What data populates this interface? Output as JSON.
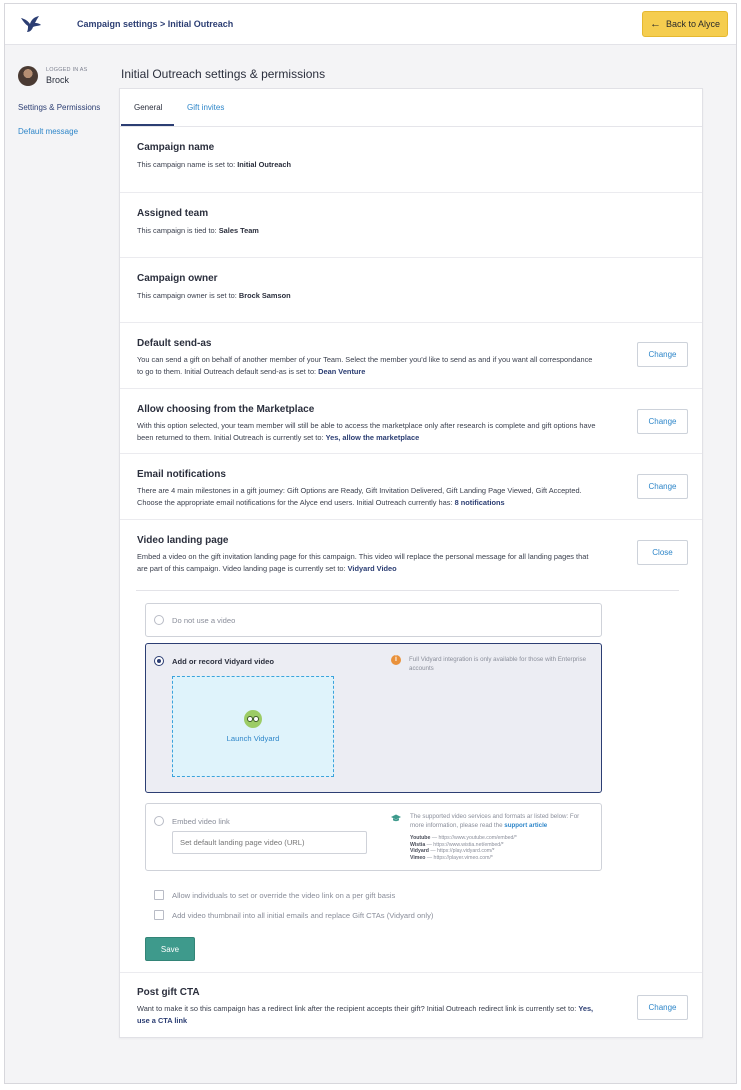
{
  "header": {
    "breadcrumb": "Campaign settings > Initial Outreach",
    "back_label": "Back to Alyce"
  },
  "sidebar": {
    "logged_label": "LOGGED IN AS",
    "user_name": "Brock",
    "items": [
      {
        "label": "Settings & Permissions"
      },
      {
        "label": "Default message"
      }
    ]
  },
  "page": {
    "title": "Initial Outreach settings & permissions"
  },
  "tabs": [
    {
      "label": "General",
      "active": true
    },
    {
      "label": "Gift invites",
      "active": false
    }
  ],
  "sections": {
    "campaign_name": {
      "title": "Campaign name",
      "text": "This campaign name is set to: ",
      "value": "Initial Outreach"
    },
    "assigned_team": {
      "title": "Assigned team",
      "text": "This campaign is tied to: ",
      "value": "Sales Team"
    },
    "campaign_owner": {
      "title": "Campaign owner",
      "text": "This campaign owner is set to: ",
      "value": "Brock Samson"
    },
    "default_send_as": {
      "title": "Default send-as",
      "text": "You can send a gift on behalf of another member of your Team. Select the member you'd like to send as and if you want all correspondance to go to them. Initial Outreach default send-as is set to: ",
      "value": "Dean Venture",
      "button": "Change"
    },
    "marketplace": {
      "title": "Allow choosing from the Marketplace",
      "text": "With this option selected, your team member will still be able to access the marketplace only after research is complete and gift options have been returned to them. Initial Outreach is currently set to: ",
      "value": "Yes, allow the marketplace",
      "button": "Change"
    },
    "email_notifications": {
      "title": "Email notifications",
      "text": "There are 4 main milestones in a gift journey: Gift Options are Ready, Gift Invitation Delivered, Gift Landing Page Viewed, Gift Accepted. Choose the appropriate email notifications for the Alyce end users. Initial Outreach currently has: ",
      "value": "8 notifications",
      "button": "Change"
    },
    "video_landing": {
      "title": "Video landing page",
      "text": "Embed a video on the gift invitation landing page for this campaign. This video will replace the personal message for all landing pages that are part of this campaign. Video landing page is currently set to: ",
      "value": "Vidyard Video",
      "button": "Close"
    },
    "post_gift_cta": {
      "title": "Post gift CTA",
      "text": "Want to make it so this campaign has a redirect link after the recipient accepts their gift? Initial Outreach redirect link is currently set to: ",
      "value": "Yes, use a CTA link",
      "button": "Change"
    }
  },
  "video_options": {
    "no_video": {
      "label": "Do not use a video",
      "selected": false
    },
    "vidyard": {
      "label": "Add or record Vidyard video",
      "selected": true,
      "launch_label": "Launch Vidyard",
      "info": "Full Vidyard integration is only available for those with Enterprise accounts"
    },
    "embed": {
      "label": "Embed video link",
      "selected": false,
      "placeholder": "Set default landing page video (URL)",
      "support_text": "The supported video services and formats ar listed below: For more information, please read the ",
      "support_link": "support article",
      "services": [
        {
          "name": "Youtube",
          "url": " — https://www.youtube.com/embed/*"
        },
        {
          "name": "Wistia",
          "url": " — https://www.wistia.net/embed/*"
        },
        {
          "name": "Vidyard",
          "url": " — https://play.vidyard.com/*"
        },
        {
          "name": "Vimeo",
          "url": " — https://player.vimeo.com/*"
        }
      ]
    },
    "checkbox_override": "Allow individuals to set or override the video link on a per gift basis",
    "checkbox_thumbnail": "Add video thumbnail into all initial emails and replace Gift CTAs (Vidyard only)",
    "save_label": "Save"
  }
}
